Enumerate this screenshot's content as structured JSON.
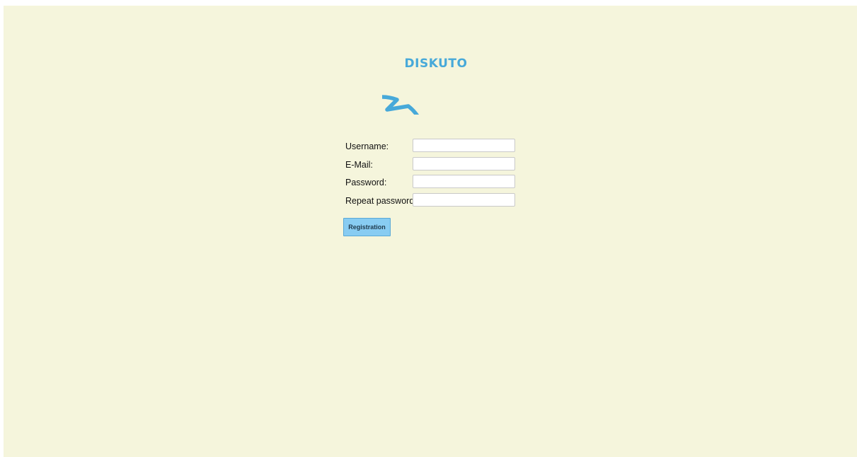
{
  "app": {
    "logo_text": "DISKUTO",
    "brand_color": "#47a9d9",
    "background_color": "#f5f5dc"
  },
  "form": {
    "fields": [
      {
        "label": "Username:",
        "value": "",
        "placeholder": ""
      },
      {
        "label": "E-Mail:",
        "value": "",
        "placeholder": ""
      },
      {
        "label": "Password:",
        "value": "",
        "placeholder": ""
      },
      {
        "label": "Repeat password:",
        "value": "",
        "placeholder": ""
      }
    ],
    "submit_label": "Registration"
  }
}
